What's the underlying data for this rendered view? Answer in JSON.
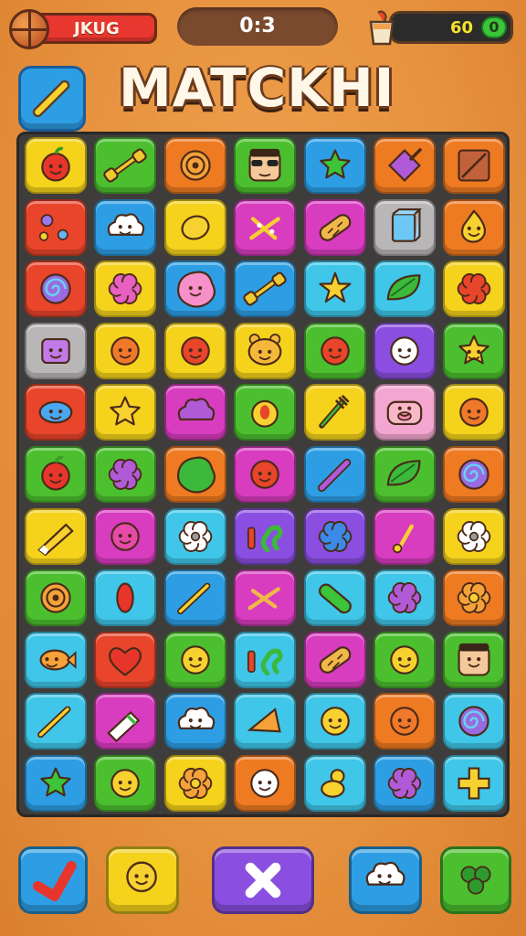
{
  "hud": {
    "left_label": "JKUG",
    "timer": "0:3",
    "score": "60",
    "badge": "0"
  },
  "header": {
    "title": "MATCKHI"
  },
  "colors": {
    "yellow": "#f5d21c",
    "green": "#4cbf2f",
    "orange": "#ee7a22",
    "blue": "#2e9ee4",
    "cyan": "#3fc6e8",
    "magenta": "#d83cbf",
    "purple": "#8a4fe0",
    "gray": "#b9b6b8",
    "red": "#e8452b",
    "pink": "#f3a6cf"
  },
  "board": {
    "rows": [
      [
        [
          "yellow",
          "apple-face-icon"
        ],
        [
          "green",
          "dumbbell-icon"
        ],
        [
          "orange",
          "target-icon"
        ],
        [
          "green",
          "sunglasses-face-icon"
        ],
        [
          "blue",
          "green-star-icon"
        ],
        [
          "orange",
          "purple-diamond-icon"
        ],
        [
          "orange",
          "red-box-icon"
        ]
      ],
      [
        [
          "red",
          "flower-sprinkle-icon"
        ],
        [
          "blue",
          "cloud-face-icon"
        ],
        [
          "yellow",
          "egg-icon"
        ],
        [
          "magenta",
          "fireworks-icon"
        ],
        [
          "magenta",
          "bread-icon"
        ],
        [
          "gray",
          "blue-cube-icon"
        ],
        [
          "orange",
          "drop-face-icon"
        ]
      ],
      [
        [
          "red",
          "swirl-icon"
        ],
        [
          "yellow",
          "flower-icon"
        ],
        [
          "blue",
          "pink-blob-icon"
        ],
        [
          "blue",
          "dumbbell-icon"
        ],
        [
          "cyan",
          "burst-icon"
        ],
        [
          "cyan",
          "leaf-icon"
        ],
        [
          "yellow",
          "red-flower-icon"
        ]
      ],
      [
        [
          "gray",
          "purple-square-face-icon"
        ],
        [
          "yellow",
          "orange-face-icon"
        ],
        [
          "yellow",
          "red-face-icon"
        ],
        [
          "yellow",
          "bear-face-icon"
        ],
        [
          "green",
          "red-face-icon"
        ],
        [
          "purple",
          "white-face-icon"
        ],
        [
          "green",
          "yellow-star-face-icon"
        ]
      ],
      [
        [
          "red",
          "blue-blob-face-icon"
        ],
        [
          "yellow",
          "yellow-star-icon"
        ],
        [
          "magenta",
          "purple-cloud-icon"
        ],
        [
          "green",
          "fruit-icon"
        ],
        [
          "yellow",
          "fork-icon"
        ],
        [
          "pink",
          "pig-face-icon"
        ],
        [
          "yellow",
          "orange-face-icon"
        ]
      ],
      [
        [
          "green",
          "apple-face-icon"
        ],
        [
          "green",
          "purple-flower-icon"
        ],
        [
          "orange",
          "green-blob-icon"
        ],
        [
          "magenta",
          "red-face-icon"
        ],
        [
          "blue",
          "wand-icon"
        ],
        [
          "green",
          "leaf-icon"
        ],
        [
          "orange",
          "swirl-icon"
        ]
      ],
      [
        [
          "yellow",
          "crayon-icon"
        ],
        [
          "magenta",
          "pink-face-icon"
        ],
        [
          "cyan",
          "gear-icon"
        ],
        [
          "purple",
          "seahorse-icon"
        ],
        [
          "purple",
          "blue-flower-icon"
        ],
        [
          "magenta",
          "note-icon"
        ],
        [
          "yellow",
          "gear-icon"
        ]
      ],
      [
        [
          "green",
          "target-icon"
        ],
        [
          "cyan",
          "red-leaf-icon"
        ],
        [
          "blue",
          "pencil-icon"
        ],
        [
          "magenta",
          "sticks-icon"
        ],
        [
          "cyan",
          "green-pill-icon"
        ],
        [
          "cyan",
          "purple-flower-icon"
        ],
        [
          "orange",
          "sun-flower-icon"
        ]
      ],
      [
        [
          "cyan",
          "fish-face-icon"
        ],
        [
          "red",
          "heart-icon"
        ],
        [
          "green",
          "yellow-face-icon"
        ],
        [
          "cyan",
          "seahorse-icon"
        ],
        [
          "magenta",
          "bread-icon"
        ],
        [
          "green",
          "yellow-face-icon"
        ],
        [
          "green",
          "boy-face-icon"
        ]
      ],
      [
        [
          "cyan",
          "pencil-icon"
        ],
        [
          "magenta",
          "tube-icon"
        ],
        [
          "blue",
          "cloud-face-icon"
        ],
        [
          "cyan",
          "megaphone-icon"
        ],
        [
          "cyan",
          "yellow-face-icon"
        ],
        [
          "orange",
          "orange-face-icon"
        ],
        [
          "cyan",
          "swirl-icon"
        ]
      ],
      [
        [
          "blue",
          "green-star-icon"
        ],
        [
          "green",
          "yellow-face-icon"
        ],
        [
          "yellow",
          "sun-flower-icon"
        ],
        [
          "orange",
          "white-face-icon"
        ],
        [
          "cyan",
          "duck-icon"
        ],
        [
          "blue",
          "purple-flower-icon"
        ],
        [
          "cyan",
          "cross-icon"
        ]
      ]
    ]
  },
  "footer": {
    "buttons": [
      [
        "blue",
        "heart-check-icon"
      ],
      [
        "yellow",
        "yellow-face-icon"
      ],
      [
        "purple",
        "close-icon"
      ],
      [
        "blue",
        "cloud-face-icon"
      ],
      [
        "green",
        "clover-icon"
      ]
    ]
  }
}
